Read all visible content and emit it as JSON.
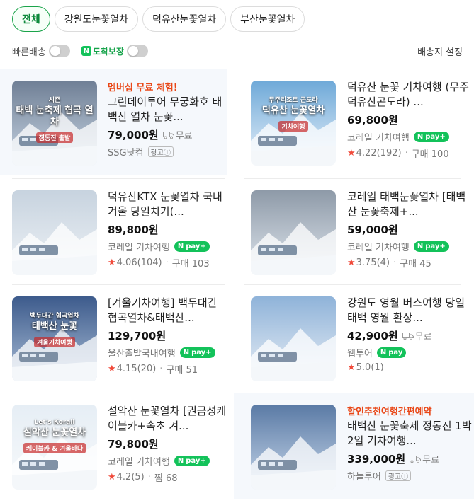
{
  "chips": [
    "전체",
    "강원도눈꽃열차",
    "덕유산눈꽃열차",
    "부산눈꽃열차"
  ],
  "filters": {
    "fast_delivery": "빠른배송",
    "arrival_badge": "N",
    "arrival_guarantee": "도착보장",
    "ship_settings": "배송지 설정"
  },
  "products": [
    {
      "promo": "멤버십 무료 체험!",
      "title": "그린데이투어 무궁화호 태백산 열차 눈꽃...",
      "price": "79,000원",
      "shipping": "무료",
      "seller": "SSG닷컴",
      "ad": "광고ⓘ",
      "thumb_caption": "태백 눈축제 협곡 열차",
      "thumb_sub": "시즌",
      "thumb_sub2": "정동진 출발",
      "thumb_colors": [
        "#6f7f95",
        "#c9d6e4"
      ]
    },
    {
      "title": "덕유산 눈꽃 기차여행 (무주덕유산곤도라) ...",
      "price": "69,800원",
      "seller": "코레일 기차여행",
      "npay": "pay+",
      "rating": "4.22",
      "reviews": "(192)",
      "purchase": "구매 100",
      "thumb_caption": "덕유산 눈꽃열차",
      "thumb_sub": "무주리조트 곤도라",
      "thumb_sub2": "기차여행",
      "thumb_colors": [
        "#6ea9d8",
        "#e9f1fa"
      ]
    },
    {
      "title": "덕유산KTX 눈꽃열차 국내 겨울 당일치기(...",
      "price": "89,800원",
      "seller": "코레일 기차여행",
      "npay": "pay+",
      "rating": "4.06",
      "reviews": "(104)",
      "purchase": "구매 103",
      "thumb_colors": [
        "#c7d3df",
        "#eef2f6"
      ]
    },
    {
      "title": "코레일 태백눈꽃열차 [태백산 눈꽃축제+...",
      "price": "59,000원",
      "seller": "코레일 기차여행",
      "npay": "pay+",
      "rating": "3.75",
      "reviews": "(4)",
      "purchase": "구매 45",
      "thumb_colors": [
        "#8e9aa8",
        "#dfe6ee"
      ]
    },
    {
      "title": "[겨울기차여행] 백두대간 협곡열차&태백산...",
      "price": "129,700원",
      "seller": "울산출발국내여행",
      "npay": "pay+",
      "rating": "4.15",
      "reviews": "(20)",
      "purchase": "구매 51",
      "thumb_caption": "태백산 눈꽃",
      "thumb_sub": "백두대간 협곡열차",
      "thumb_sub2": "겨울기차여행",
      "thumb_colors": [
        "#3d5b8c",
        "#a9bdd6"
      ]
    },
    {
      "title": "강원도 영월 버스여행 당일 태백 영월 환상...",
      "price": "42,900원",
      "shipping": "무료",
      "seller": "웹투어",
      "npay": "pay",
      "rating": "5.0",
      "reviews": "(1)",
      "thumb_colors": [
        "#8fb3d9",
        "#e8eef5"
      ]
    },
    {
      "title": "설악산 눈꽃열차 [권금성케이블카+속초 겨...",
      "price": "79,800원",
      "seller": "코레일 기차여행",
      "npay": "pay+",
      "rating": "4.2",
      "reviews": "(5)",
      "purchase": "찜 68",
      "thumb_caption": "설악산 눈꽃열차",
      "thumb_sub": "Let's Korail",
      "thumb_sub2": "케이블카 & 겨울바다",
      "thumb_colors": [
        "#e6eef5",
        "#f7f9fb"
      ]
    },
    {
      "promo": "할인추천여행간편예약",
      "title": "태백산 눈꽃축제 정동진 1박2일 기차여행...",
      "price": "339,000원",
      "shipping": "무료",
      "seller": "하늘투어",
      "ad": "광고ⓘ",
      "thumb_colors": [
        "#5a7aa5",
        "#c7d7ea"
      ]
    }
  ]
}
